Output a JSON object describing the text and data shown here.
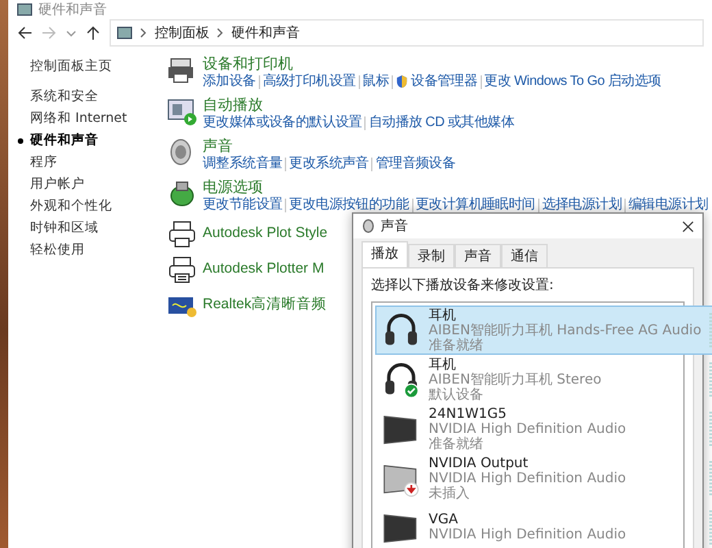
{
  "window": {
    "title": "硬件和声音"
  },
  "address_bar": {
    "breadcrumbs": [
      "控制面板",
      "硬件和声音"
    ]
  },
  "sidebar": {
    "items": [
      {
        "label": "控制面板主页",
        "selected": false
      },
      {
        "label": "系统和安全",
        "selected": false
      },
      {
        "label": "网络和 Internet",
        "selected": false
      },
      {
        "label": "硬件和声音",
        "selected": true
      },
      {
        "label": "程序",
        "selected": false
      },
      {
        "label": "用户帐户",
        "selected": false
      },
      {
        "label": "外观和个性化",
        "selected": false
      },
      {
        "label": "时钟和区域",
        "selected": false
      },
      {
        "label": "轻松使用",
        "selected": false
      }
    ]
  },
  "categories": [
    {
      "title": "设备和打印机",
      "kind": "printer",
      "links": [
        {
          "label": "添加设备",
          "shield": false
        },
        {
          "label": "高级打印机设置",
          "shield": false
        },
        {
          "label": "鼠标",
          "shield": false
        },
        {
          "label": "设备管理器",
          "shield": true
        },
        {
          "label": "更改 Windows To Go 启动选项",
          "shield": false
        }
      ]
    },
    {
      "title": "自动播放",
      "kind": "autoplay",
      "links": [
        {
          "label": "更改媒体或设备的默认设置",
          "shield": false
        },
        {
          "label": "自动播放 CD 或其他媒体",
          "shield": false
        }
      ]
    },
    {
      "title": "声音",
      "kind": "speaker",
      "links": [
        {
          "label": "调整系统音量",
          "shield": false
        },
        {
          "label": "更改系统声音",
          "shield": false
        },
        {
          "label": "管理音频设备",
          "shield": false
        }
      ]
    },
    {
      "title": "电源选项",
      "kind": "power",
      "links": [
        {
          "label": "更改节能设置",
          "shield": false
        },
        {
          "label": "更改电源按钮的功能",
          "shield": false
        },
        {
          "label": "更改计算机睡眠时间",
          "shield": false
        },
        {
          "label": "选择电源计划",
          "shield": false
        },
        {
          "label": "编辑电源计划",
          "shield": false
        }
      ]
    },
    {
      "title": "Autodesk Plot Style",
      "kind": "plot-printer"
    },
    {
      "title": "Autodesk Plotter M",
      "kind": "plotter"
    },
    {
      "title": "Realtek高清晰音频",
      "kind": "realtek"
    }
  ],
  "sound_dialog": {
    "title": "声音",
    "tabs": [
      {
        "label": "播放",
        "selected": true
      },
      {
        "label": "录制",
        "selected": false
      },
      {
        "label": "声音",
        "selected": false
      },
      {
        "label": "通信",
        "selected": false
      }
    ],
    "instruction": "选择以下播放设备来修改设置:",
    "devices": [
      {
        "name": "耳机",
        "description": "AIBEN智能听力耳机 Hands-Free AG Audio",
        "status": "准备就绪",
        "kind": "headphones",
        "default_device": false,
        "unplugged": false,
        "selected": true
      },
      {
        "name": "耳机",
        "description": "AIBEN智能听力耳机 Stereo",
        "status": "默认设备",
        "kind": "headphones",
        "default_device": true,
        "unplugged": false,
        "selected": false
      },
      {
        "name": "24N1W1G5",
        "description": "NVIDIA High Definition Audio",
        "status": "准备就绪",
        "kind": "monitor",
        "default_device": false,
        "unplugged": false,
        "selected": false
      },
      {
        "name": "NVIDIA Output",
        "description": "NVIDIA High Definition Audio",
        "status": "未插入",
        "kind": "monitor",
        "default_device": false,
        "unplugged": true,
        "selected": false
      },
      {
        "name": "VGA",
        "description": "NVIDIA High Definition Audio",
        "kind": "monitor",
        "default_device": false,
        "unplugged": false,
        "selected": false
      }
    ]
  }
}
